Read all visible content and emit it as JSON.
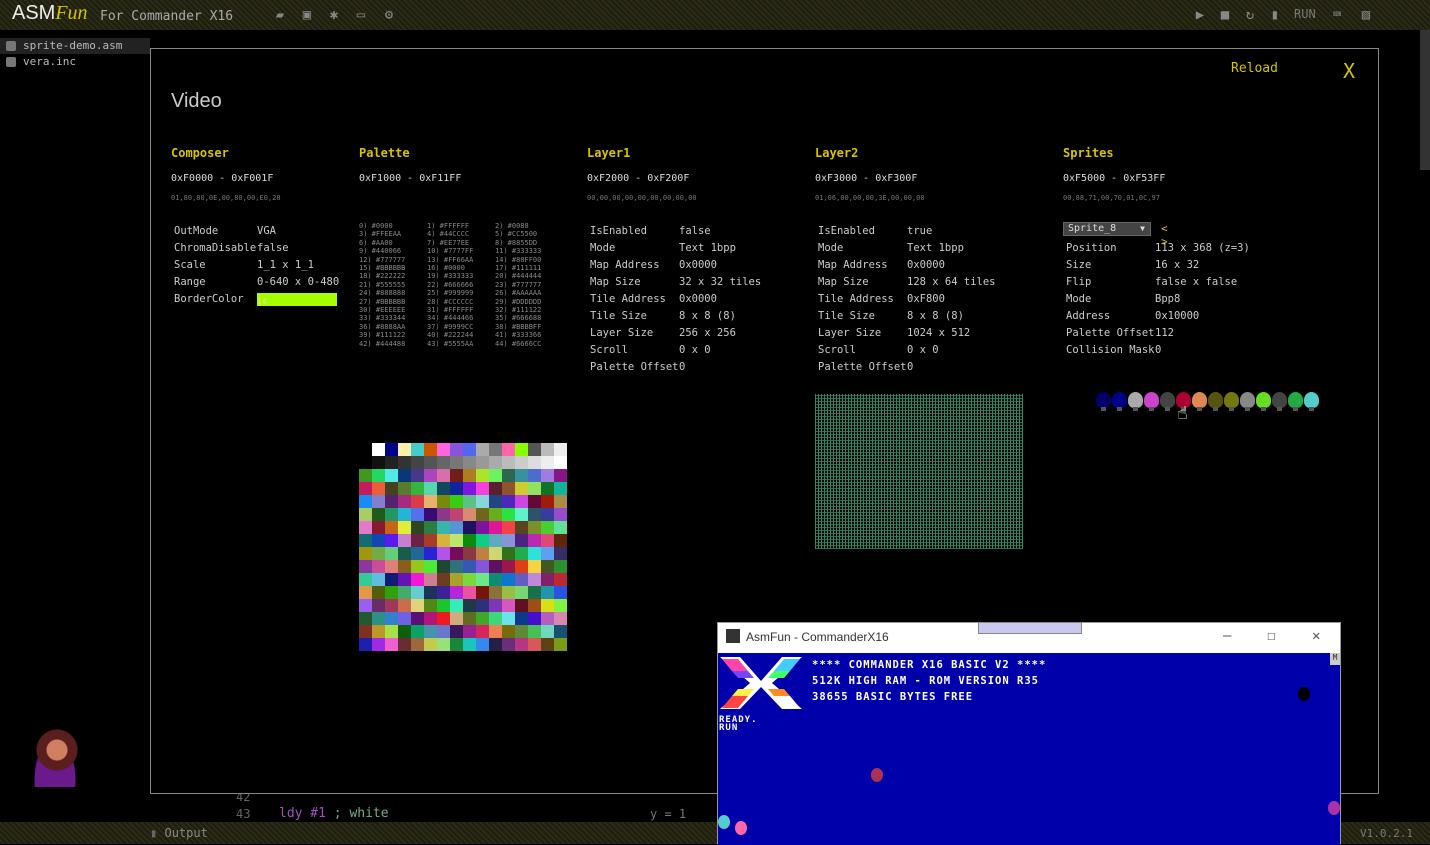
{
  "app": {
    "logo_main": "ASM",
    "logo_fun": "Fun",
    "subtitle": "For Commander X16",
    "run_label": "RUN",
    "version": "V1.0.2.1"
  },
  "toolbar_icons": [
    "folder-icon",
    "save-icon",
    "bug-icon",
    "monitor-icon",
    "gear-icon"
  ],
  "toolbar_right_icons": [
    "play-icon",
    "stop-icon",
    "refresh-icon",
    "memory-icon",
    "keyboard-icon",
    "image-icon"
  ],
  "files": [
    "sprite-demo.asm",
    "vera.inc"
  ],
  "editor": {
    "line_42": "42",
    "line_43": "43",
    "code": "ldy #1  ; white",
    "cursor_info": "y = 1"
  },
  "status": {
    "output_label": "Output"
  },
  "video": {
    "reload": "Reload",
    "close": "X",
    "title": "Video",
    "composer": {
      "title": "Composer",
      "range": "0xF0000 - 0xF001F",
      "bytes": "01,80,80,0E,00,80,00,E0,28",
      "props": [
        {
          "k": "OutMode",
          "v": "VGA"
        },
        {
          "k": "ChromaDisable",
          "v": "false"
        },
        {
          "k": "Scale",
          "v": "1_1 x 1_1"
        },
        {
          "k": "Range",
          "v": "0-640 x 0-480"
        },
        {
          "k": "BorderColor",
          "v": "14"
        }
      ]
    },
    "palette": {
      "title": "Palette",
      "range": "0xF1000 - 0xF11FF",
      "col1": [
        "0) #0000",
        "3) #FFEEAA",
        "6) #AA00",
        "9) #440066",
        "12) #777777",
        "15) #BBBBBB",
        "18) #222222",
        "21) #555555",
        "24) #888888",
        "27) #BBBBBB",
        "30) #EEEEEE",
        "33) #333344",
        "36) #8888AA",
        "39) #111122",
        "42) #444488"
      ],
      "col2": [
        "1) #FFFFFF",
        "4) #44CCCC",
        "7) #EE77EE",
        "10) #7777FF",
        "13) #FF66AA",
        "16) #0000",
        "19) #333333",
        "22) #666666",
        "25) #999999",
        "28) #CCCCCC",
        "31) #FFFFFF",
        "34) #444466",
        "37) #9999CC",
        "40) #222244",
        "43) #5555AA"
      ],
      "col3": [
        "2) #0088",
        "5) #CC5500",
        "8) #8855DD",
        "11) #333333",
        "14) #88FF00",
        "17) #111111",
        "20) #444444",
        "23) #777777",
        "26) #AAAAAA",
        "29) #DDDDDD",
        "32) #111122",
        "35) #666688",
        "38) #BBBBFF",
        "41) #333366",
        "44) #6666CC"
      ]
    },
    "layer1": {
      "title": "Layer1",
      "range": "0xF2000 - 0xF200F",
      "bytes": "00,00,00,00,00,00,00,00,00",
      "props": [
        {
          "k": "IsEnabled",
          "v": "false"
        },
        {
          "k": "Mode",
          "v": "Text 1bpp"
        },
        {
          "k": "Map Address",
          "v": "0x0000"
        },
        {
          "k": "Map Size",
          "v": "32 x 32 tiles"
        },
        {
          "k": "Tile Address",
          "v": "0x0000"
        },
        {
          "k": "Tile Size",
          "v": "8 x 8 (8)"
        },
        {
          "k": "Layer Size",
          "v": "256 x 256"
        },
        {
          "k": "Scroll",
          "v": "0 x 0"
        },
        {
          "k": "Palette Offset",
          "v": "0"
        }
      ]
    },
    "layer2": {
      "title": "Layer2",
      "range": "0xF3000 - 0xF300F",
      "bytes": "01,06,00,00,00,3E,00,00,00",
      "props": [
        {
          "k": "IsEnabled",
          "v": "true"
        },
        {
          "k": "Mode",
          "v": "Text 1bpp"
        },
        {
          "k": "Map Address",
          "v": "0x0000"
        },
        {
          "k": "Map Size",
          "v": "128 x 64 tiles"
        },
        {
          "k": "Tile Address",
          "v": "0xF800"
        },
        {
          "k": "Tile Size",
          "v": "8 x 8 (8)"
        },
        {
          "k": "Layer Size",
          "v": "1024 x 512"
        },
        {
          "k": "Scroll",
          "v": "0 x 0"
        },
        {
          "k": "Palette Offset",
          "v": "0"
        }
      ]
    },
    "sprites": {
      "title": "Sprites",
      "range": "0xF5000 - 0xF53FF",
      "bytes": "00,88,71,00,70,01,0C,97",
      "selected": "Sprite_8",
      "nav": "< >",
      "props": [
        {
          "k": "Position",
          "v": "113 x 368 (z=3)"
        },
        {
          "k": "Size",
          "v": "16 x 32"
        },
        {
          "k": "Flip",
          "v": "false x false"
        },
        {
          "k": "Mode",
          "v": "Bpp8"
        },
        {
          "k": "Address",
          "v": "0x10000"
        },
        {
          "k": "Palette Offset",
          "v": "112"
        },
        {
          "k": "Collision Mask",
          "v": "0"
        }
      ],
      "thumb_colors": [
        "#000066",
        "#000088",
        "#aaaaaa",
        "#cc44cc",
        "#444444",
        "#aa0033",
        "#dd8855",
        "#555511",
        "#777711",
        "#888888",
        "#66dd22",
        "#444444",
        "#22aa44",
        "#55cccc"
      ]
    }
  },
  "emulator": {
    "title": "AsmFun - CommanderX16",
    "min": "—",
    "max": "☐",
    "close": "✕",
    "line1": "**** COMMANDER X16 BASIC V2 ****",
    "line2": "512K HIGH RAM - ROM VERSION R35",
    "line3": "38655 BASIC BYTES FREE",
    "ready": "READY.",
    "run": "RUN",
    "scroll_mark": "M"
  }
}
